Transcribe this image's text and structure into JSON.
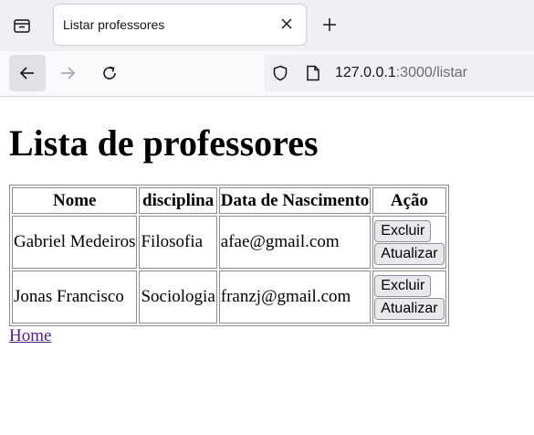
{
  "browser": {
    "tab_title": "Listar professores",
    "url_host": "127.0.0.1",
    "url_rest": ":3000/listar"
  },
  "page": {
    "heading": "Lista de professores",
    "table": {
      "headers": [
        "Nome",
        "disciplina",
        "Data de Nascimento",
        "Ação"
      ],
      "rows": [
        {
          "nome": "Gabriel Medeiros",
          "disciplina": "Filosofia",
          "data": "afae@gmail.com"
        },
        {
          "nome": "Jonas Francisco",
          "disciplina": "Sociologia",
          "data": "franzj@gmail.com"
        }
      ],
      "delete_label": "Excluir",
      "update_label": "Atualizar"
    },
    "home_link": "Home"
  }
}
